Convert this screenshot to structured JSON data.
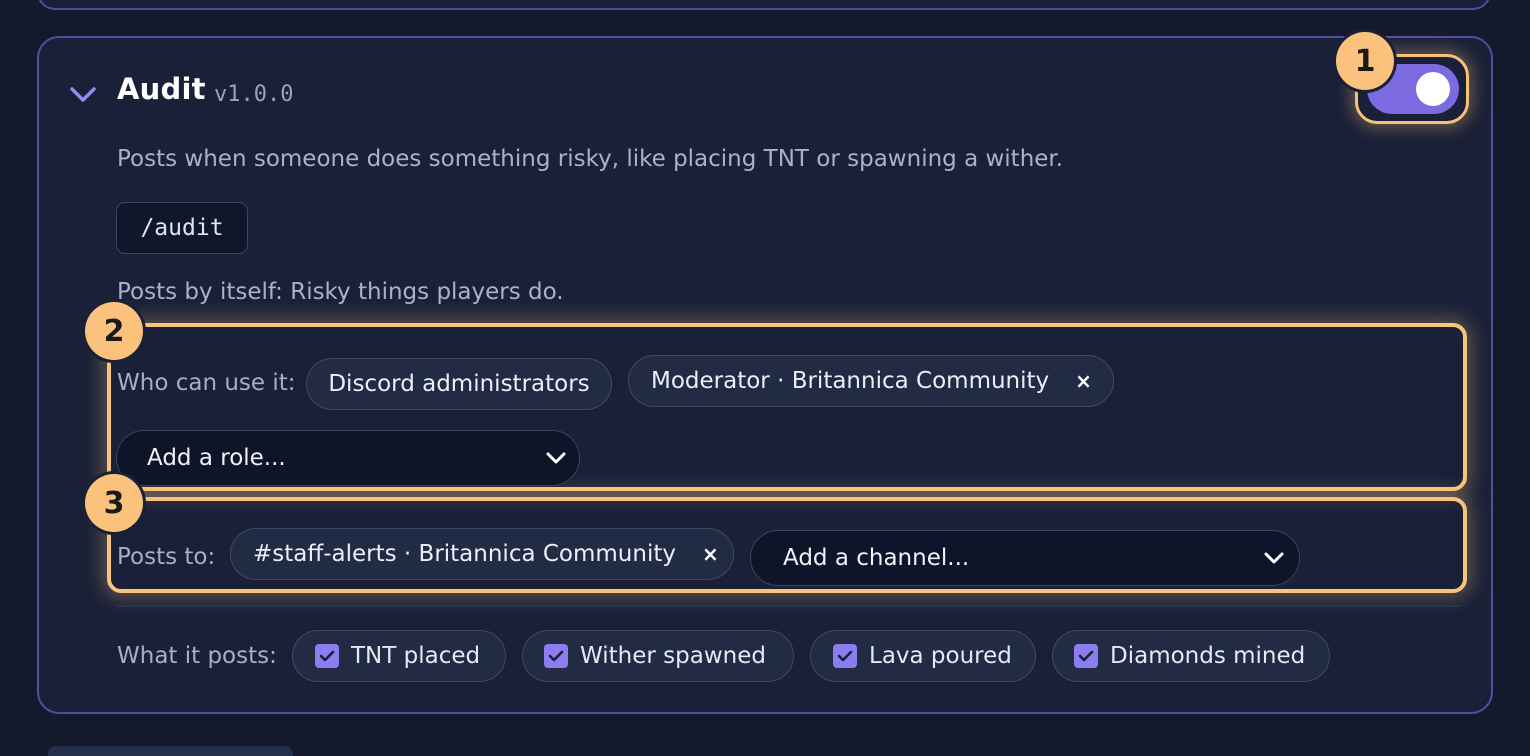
{
  "module": {
    "title": "Audit",
    "version": "v1.0.0",
    "enabled": true,
    "description": "Posts when someone does something risky, like placing TNT or spawning a wither.",
    "command": "/audit",
    "auto_posts": "Posts by itself: Risky things players do."
  },
  "badges": [
    "1",
    "2",
    "3"
  ],
  "roles": {
    "label": "Who can use it:",
    "chips": [
      {
        "text": "Discord administrators",
        "removable": false
      },
      {
        "text": "Moderator · Britannica Community",
        "removable": true
      }
    ],
    "remove_glyph": "×",
    "select_placeholder": "Add a role..."
  },
  "channels": {
    "label": "Posts to:",
    "chips": [
      {
        "text": "#staff-alerts · Britannica Community",
        "removable": true
      }
    ],
    "remove_glyph": "×",
    "select_placeholder": "Add a channel..."
  },
  "events": {
    "label": "What it posts:",
    "items": [
      {
        "text": "TNT placed",
        "checked": true
      },
      {
        "text": "Wither spawned",
        "checked": true
      },
      {
        "text": "Lava poured",
        "checked": true
      },
      {
        "text": "Diamonds mined",
        "checked": true
      }
    ]
  },
  "colors": {
    "accent": "#7c6ae0",
    "highlight": "#f8c47c",
    "checkbox": "#8b7cf0",
    "background": "#141a2b",
    "card": "#1a2037"
  },
  "icons": {
    "collapse": "chevron-down-icon",
    "select": "chevron-down-icon",
    "checkbox": "check-icon",
    "remove": "close-icon"
  }
}
